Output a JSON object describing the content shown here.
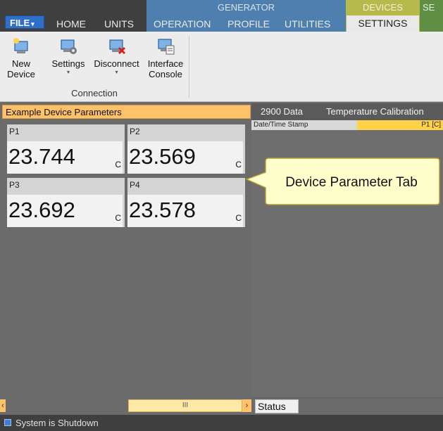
{
  "ribbon": {
    "tabs": {
      "file": "FILE",
      "home": "HOME",
      "units": "UNITS",
      "generator_group": "GENERATOR",
      "operation": "OPERATION",
      "profile": "PROFILE",
      "utilities": "UTILITIES",
      "devices_group": "DEVICES",
      "settings": "SETTINGS",
      "se_group": "SE"
    },
    "connection_group": {
      "label": "Connection",
      "buttons": {
        "new_device": [
          "New",
          "Device"
        ],
        "settings": "Settings",
        "disconnect": "Disconnect",
        "interface_console": [
          "Interface",
          "Console"
        ]
      }
    }
  },
  "left_panel": {
    "title": "Example Device Parameters",
    "params": [
      {
        "label": "P1",
        "value": "23.744",
        "unit": "C"
      },
      {
        "label": "P2",
        "value": "23.569",
        "unit": "C"
      },
      {
        "label": "P3",
        "value": "23.692",
        "unit": "C"
      },
      {
        "label": "P4",
        "value": "23.578",
        "unit": "C"
      }
    ]
  },
  "right_panel": {
    "tabs": [
      "2900 Data",
      "Temperature Calibration"
    ],
    "columns": [
      "Date/Time Stamp",
      "P1 [C]"
    ],
    "callout": "Device Parameter Tab"
  },
  "bottom": {
    "scroll_thumb": "III",
    "status_log_tab": "Status Log",
    "status_text": "System is Shutdown"
  },
  "colors": {
    "accent_orange": "#ffc169",
    "generator_blue": "#4f7fae",
    "devices_olive": "#b6b94b",
    "file_blue": "#2f6fc6"
  }
}
